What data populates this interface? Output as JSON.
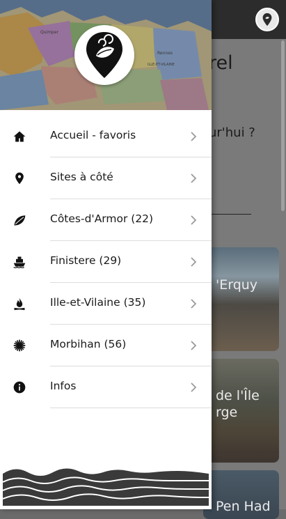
{
  "background": {
    "heading_fragment": "rel",
    "question_fragment": "ur'hui ?",
    "cards": [
      {
        "title": "'Erquy"
      },
      {
        "title": "de l'Île\nrge"
      },
      {
        "title": "Pen Had"
      }
    ]
  },
  "drawer": {
    "menu": [
      {
        "label": "Accueil - favoris",
        "icon": "home-icon"
      },
      {
        "label": "Sites à côté",
        "icon": "location-pin-icon"
      },
      {
        "label": "Côtes-d'Armor (22)",
        "icon": "leaf-icon"
      },
      {
        "label": "Finistere (29)",
        "icon": "boat-icon"
      },
      {
        "label": "Ille-et-Vilaine (35)",
        "icon": "flame-icon"
      },
      {
        "label": "Morbihan (56)",
        "icon": "sun-burst-icon"
      },
      {
        "label": "Infos",
        "icon": "info-icon"
      }
    ],
    "map_labels": [
      "Quimper",
      "Rennes",
      "ILLE-ET-VILAINE"
    ]
  },
  "colors": {
    "topbar": "#2c2c2c",
    "drawer_bg": "#ffffff",
    "text": "#1a1a1a",
    "separator": "#dcdcdc",
    "waves": "#3a3a3a"
  }
}
